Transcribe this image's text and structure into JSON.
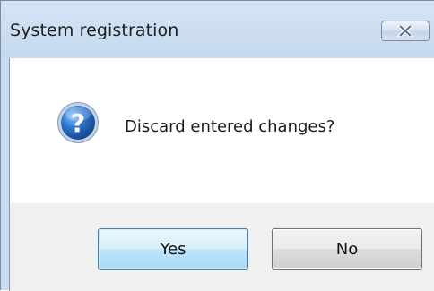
{
  "window": {
    "title": "System registration"
  },
  "titlebar": {
    "close_icon": "close-icon"
  },
  "dialog": {
    "icon": "question-icon",
    "message": "Discard entered changes?"
  },
  "buttons": {
    "yes_label": "Yes",
    "no_label": "No"
  },
  "colors": {
    "titlebar": "#c9dbee",
    "default_button": "#bee6fd",
    "icon_blue": "#1f5ea8"
  }
}
